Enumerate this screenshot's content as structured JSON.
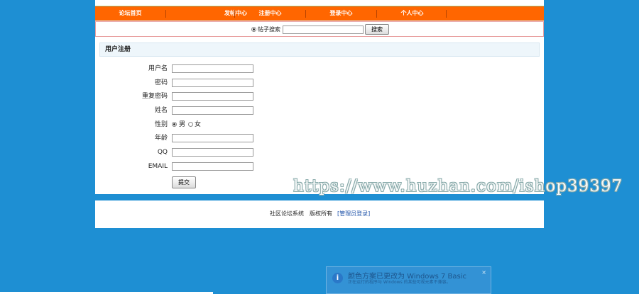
{
  "nav": {
    "items": [
      {
        "label": "论坛首页"
      },
      {
        "label": "发帖中心"
      },
      {
        "label": "注册中心"
      },
      {
        "label": "登录中心"
      },
      {
        "label": "个人中心"
      }
    ]
  },
  "search": {
    "radio_label": "帖子搜索",
    "value": "",
    "button_label": "搜索"
  },
  "form": {
    "title": "用户注册",
    "fields": [
      {
        "label": "用户名",
        "value": ""
      },
      {
        "label": "密码",
        "value": ""
      },
      {
        "label": "重复密码",
        "value": ""
      },
      {
        "label": "姓名",
        "value": ""
      },
      {
        "label": "年龄",
        "value": ""
      },
      {
        "label": "QQ",
        "value": ""
      },
      {
        "label": "EMAIL",
        "value": ""
      }
    ],
    "gender": {
      "label": "性别",
      "options": [
        "男",
        "女"
      ],
      "selected": "男"
    },
    "submit_label": "提交"
  },
  "footer": {
    "system_name": "社区论坛系统",
    "copyright": "版权所有",
    "admin_link": "[管理员登录]"
  },
  "watermark": "https://www.huzhan.com/ishop39397",
  "notification": {
    "title": "颜色方案已更改为 Windows 7 Basic",
    "body": "正在运行的程序与 Windows 的某些可视元素不兼容。",
    "icon": "info-icon"
  },
  "colors": {
    "background": "#1e8fd3",
    "nav_bar": "#ff6600"
  }
}
